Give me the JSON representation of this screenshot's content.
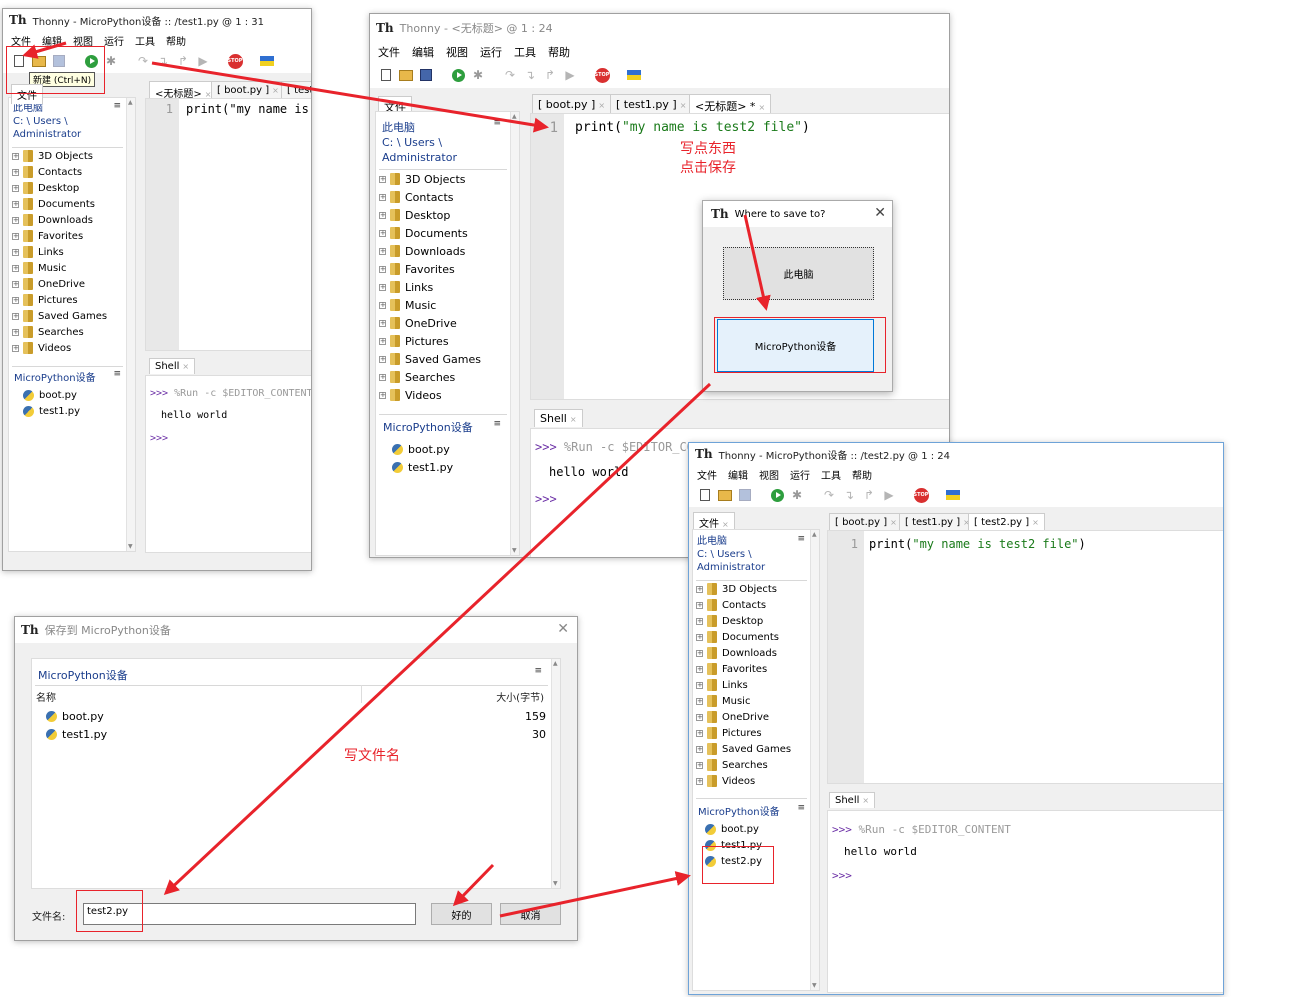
{
  "colors": {
    "annotation": "#e8232b",
    "prompt": "#6b2fa6",
    "string": "#1a7a1a",
    "location": "#1a3d8c"
  },
  "common": {
    "menu": [
      "文件",
      "编辑",
      "视图",
      "运行",
      "工具",
      "帮助"
    ],
    "folders": [
      "3D Objects",
      "Contacts",
      "Desktop",
      "Documents",
      "Downloads",
      "Favorites",
      "Links",
      "Music",
      "OneDrive",
      "Pictures",
      "Saved Games",
      "Searches",
      "Videos"
    ],
    "files_label": "文件",
    "this_pc": "此电脑",
    "path_line1": "C: \\ Users \\",
    "path_line2": "Administrator",
    "mp_title": "MicroPython设备",
    "shell_tab": "Shell",
    "shell_cmd": "%Run -c $EDITOR_CONTENT",
    "shell_prompt": ">>>",
    "shell_output": "hello world",
    "stop_label": "STOP",
    "menu_glyph": "≡"
  },
  "win1": {
    "title": "Thonny  -  MicroPython设备 :: /test1.py  @  1 : 31",
    "tooltip": "新建 (Ctrl+N)",
    "tabs": [
      "<无标题>",
      "[ boot.py ]",
      "[ test"
    ],
    "line_no": "1",
    "code": "print(\"my name is",
    "files": [
      "boot.py",
      "test1.py"
    ]
  },
  "win2": {
    "title": "Thonny  -  <无标题>  @  1 : 24",
    "tabs": [
      "[ boot.py ]",
      "[ test1.py ]",
      "<无标题> *"
    ],
    "line_no": "1",
    "code_fn": "print(",
    "code_str": "\"my name is test2 file\"",
    "code_end": ")",
    "files": [
      "boot.py",
      "test1.py"
    ]
  },
  "dialog_where": {
    "title": "Where to save to?",
    "btn_pc": "此电脑",
    "btn_mp": "MicroPython设备",
    "close": "✕"
  },
  "win3": {
    "title": "Thonny  -  MicroPython设备 :: /test2.py  @  1 : 24",
    "tabs": [
      "[ boot.py ]",
      "[ test1.py ]",
      "[ test2.py ]"
    ],
    "line_no": "1",
    "code_fn": "print(",
    "code_str": "\"my name is test2 file\"",
    "code_end": ")",
    "files": [
      "boot.py",
      "test1.py",
      "test2.py"
    ]
  },
  "save_dialog": {
    "title": "保存到 MicroPython设备",
    "location": "MicroPython设备",
    "col_name": "名称",
    "col_size": "大小(字节)",
    "rows": [
      {
        "name": "boot.py",
        "size": "159"
      },
      {
        "name": "test1.py",
        "size": "30"
      }
    ],
    "filename_label": "文件名:",
    "filename_value": "test2.py",
    "ok": "好的",
    "cancel": "取消",
    "close": "✕"
  },
  "annotations": {
    "write_something": "写点东西",
    "click_save": "点击保存",
    "write_filename": "写文件名"
  }
}
